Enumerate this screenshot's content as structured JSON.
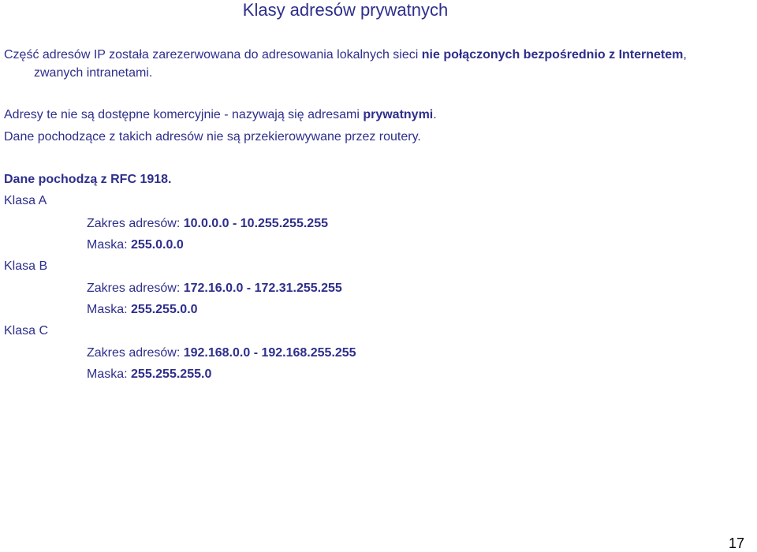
{
  "title": "Klasy adresów prywatnych",
  "intro": {
    "part1": "Część adresów IP została zarezerwowana do adresowania lokalnych sieci ",
    "bold1": "nie połączonych bezpośrednio z Internetem",
    "part2": ",",
    "line2": "zwanych intranetami."
  },
  "private_note": {
    "part1": "Adresy te nie są dostępne komercyjnie - nazywają się adresami ",
    "bold1": "prywatnymi",
    "part2": "."
  },
  "routers_note": "Dane pochodzące z takich adresów nie są przekierowywane przez routery.",
  "rfc_note": "Dane pochodzą z RFC 1918.",
  "classes": [
    {
      "name": "Klasa A",
      "range_label": "Zakres adresów:  ",
      "range_value": "10.0.0.0 -  10.255.255.255",
      "mask_label": "Maska: ",
      "mask_value": "255.0.0.0"
    },
    {
      "name": "Klasa B",
      "range_label": "Zakres adresów: ",
      "range_value": "172.16.0.0 - 172.31.255.255",
      "mask_label": "Maska: ",
      "mask_value": "255.255.0.0"
    },
    {
      "name": "Klasa C",
      "range_label": "Zakres adresów: ",
      "range_value": "192.168.0.0 - 192.168.255.255",
      "mask_label": "Maska: ",
      "mask_value": "255.255.255.0"
    }
  ],
  "page_number": "17",
  "colors": {
    "text": "#2e2e8c",
    "page_number": "#000000"
  }
}
